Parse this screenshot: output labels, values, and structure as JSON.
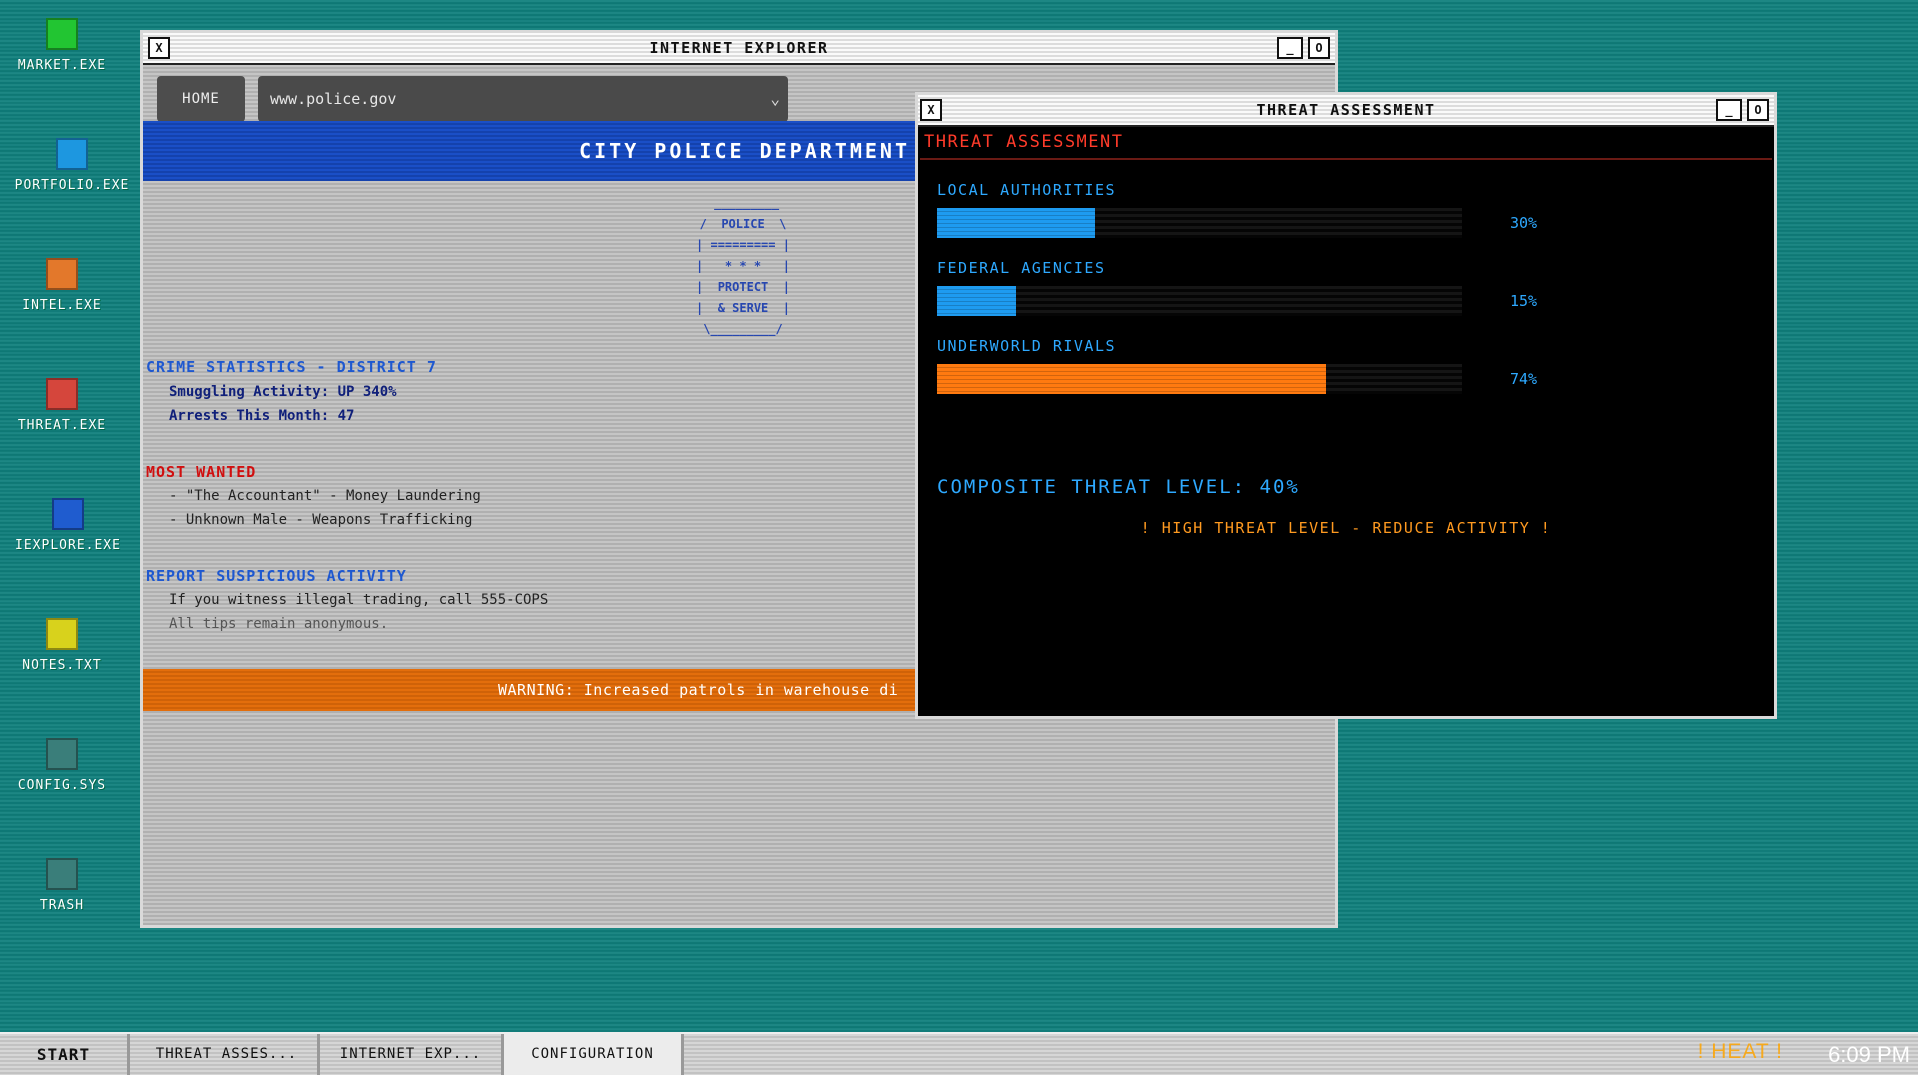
{
  "desktop": {
    "icons": [
      {
        "label": "MARKET.EXE",
        "color": "#22c532"
      },
      {
        "label": "PORTFOLIO.EXE",
        "color": "#1d97e0"
      },
      {
        "label": "INTEL.EXE",
        "color": "#e3782b"
      },
      {
        "label": "THREAT.EXE",
        "color": "#d5463c"
      },
      {
        "label": "IEXPLORE.EXE",
        "color": "#1f5ccf"
      },
      {
        "label": "NOTES.TXT",
        "color": "#d8d21c"
      },
      {
        "label": "CONFIG.SYS",
        "color": "#3a7e7a"
      },
      {
        "label": "TRASH",
        "color": "#3a7e7a"
      }
    ]
  },
  "ie_window": {
    "title": "INTERNET EXPLORER",
    "close": "X",
    "minimize": "_",
    "maximize": "O",
    "home_label": "HOME",
    "url": "www.police.gov",
    "banner_title": "CITY POLICE DEPARTMENT",
    "badge_text": " _________\n/  POLICE  \\\n| ========= |\n|   * * *   |\n|  PROTECT  |\n|  & SERVE  |\n\\_________/",
    "crime_heading": "CRIME STATISTICS - DISTRICT 7",
    "crime_lines": [
      "Smuggling Activity: UP 340%",
      "Arrests This Month: 47"
    ],
    "wanted_heading": "MOST WANTED",
    "wanted_lines": [
      "- \"The Accountant\" - Money Laundering",
      "- Unknown Male - Weapons Trafficking"
    ],
    "report_heading": "REPORT SUSPICIOUS ACTIVITY",
    "report_lines": [
      "If you witness illegal trading, call 555-COPS",
      "All tips remain anonymous."
    ],
    "warning": "WARNING: Increased patrols in warehouse di"
  },
  "threat_window": {
    "title": "THREAT ASSESSMENT",
    "close": "X",
    "minimize": "_",
    "maximize": "O",
    "heading": "THREAT ASSESSMENT",
    "bars": [
      {
        "label": "LOCAL AUTHORITIES",
        "value": 30,
        "pct_text": "30%",
        "color": "#1e9bf0"
      },
      {
        "label": "FEDERAL AGENCIES",
        "value": 15,
        "pct_text": "15%",
        "color": "#1e9bf0"
      },
      {
        "label": "UNDERWORLD RIVALS",
        "value": 74,
        "pct_text": "74%",
        "color": "#ff7a10"
      }
    ],
    "composite": "COMPOSITE THREAT LEVEL:  40%",
    "alert": "! HIGH THREAT LEVEL - REDUCE ACTIVITY !"
  },
  "taskbar": {
    "start": "START",
    "items": [
      "THREAT ASSES...",
      "INTERNET EXP...",
      "CONFIGURATION"
    ],
    "heat": "! HEAT !",
    "clock": "6:09 PM"
  }
}
